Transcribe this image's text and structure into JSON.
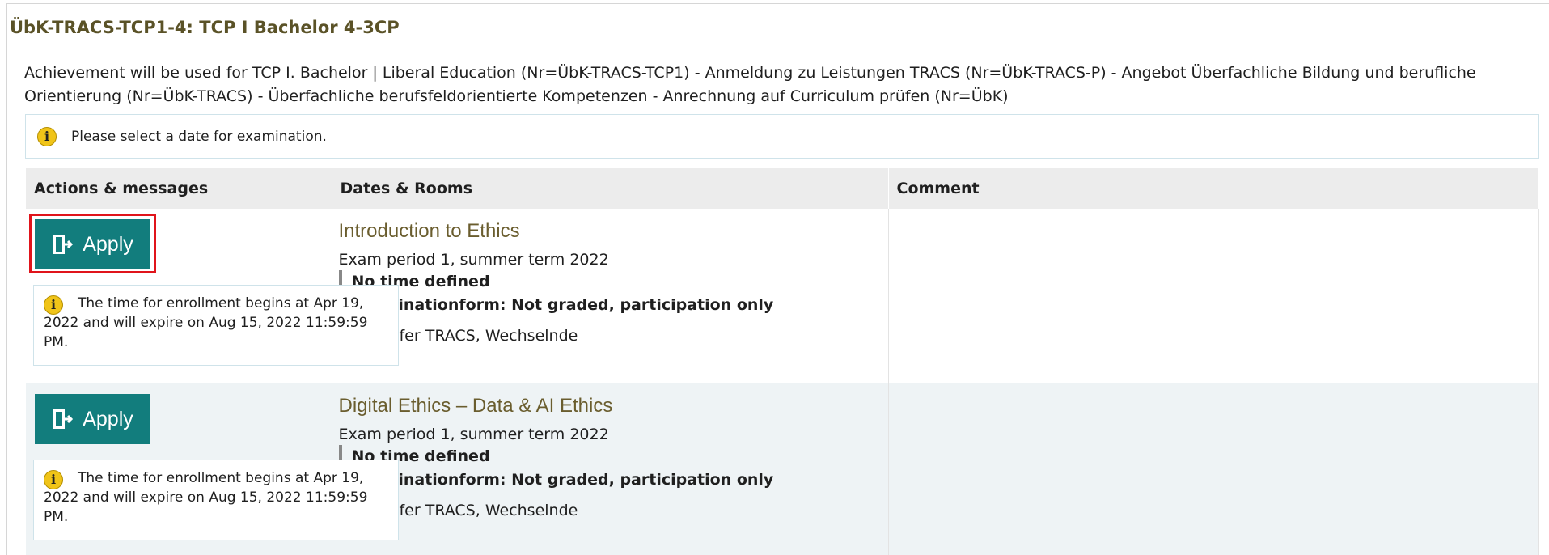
{
  "page": {
    "title": "ÜbK-TRACS-TCP1-4: TCP I Bachelor 4-3CP",
    "description": "Achievement will be used for TCP I. Bachelor | Liberal Education (Nr=ÜbK-TRACS-TCP1) - Anmeldung zu Leistungen TRACS (Nr=ÜbK-TRACS-P) - Angebot Überfachliche Bildung und berufliche Orientierung (Nr=ÜbK-TRACS) - Überfachliche berufsfeldorientierte Kompetenzen - Anrechnung auf Curriculum prüfen (Nr=ÜbK)",
    "info_message": "Please select a date for examination."
  },
  "table": {
    "headers": {
      "actions": "Actions & messages",
      "dates": "Dates & Rooms",
      "comment": "Comment"
    },
    "rows": [
      {
        "apply_label": "Apply",
        "enrollment_note": "The time for enrollment begins at Apr 19, 2022 and will expire on Aug 15, 2022 11:59:59 PM.",
        "course": "Introduction to Ethics",
        "period": "Exam period 1, summer term 2022",
        "time": "No time defined",
        "exam_form": "Examinationform: Not graded, participation only",
        "examiner": "Prüfer TRACS, Wechselnde",
        "comment": ""
      },
      {
        "apply_label": "Apply",
        "enrollment_note": "The time for enrollment begins at Apr 19, 2022 and will expire on Aug 15, 2022 11:59:59 PM.",
        "course": "Digital Ethics – Data & AI Ethics",
        "period": "Exam period 1, summer term 2022",
        "time": "No time defined",
        "exam_form": "Examinationform: Not graded, participation only",
        "examiner": "Prüfer TRACS, Wechselnde",
        "comment": ""
      }
    ]
  },
  "colors": {
    "accent_button": "#127d7d",
    "highlight_border": "#e0141b",
    "title": "#5a5227",
    "course_link": "#6a5d2e",
    "info_icon": "#f0c419"
  },
  "icons": {
    "info": "info-circle-icon",
    "apply": "door-enter-icon",
    "examiner": "clock-icon"
  }
}
